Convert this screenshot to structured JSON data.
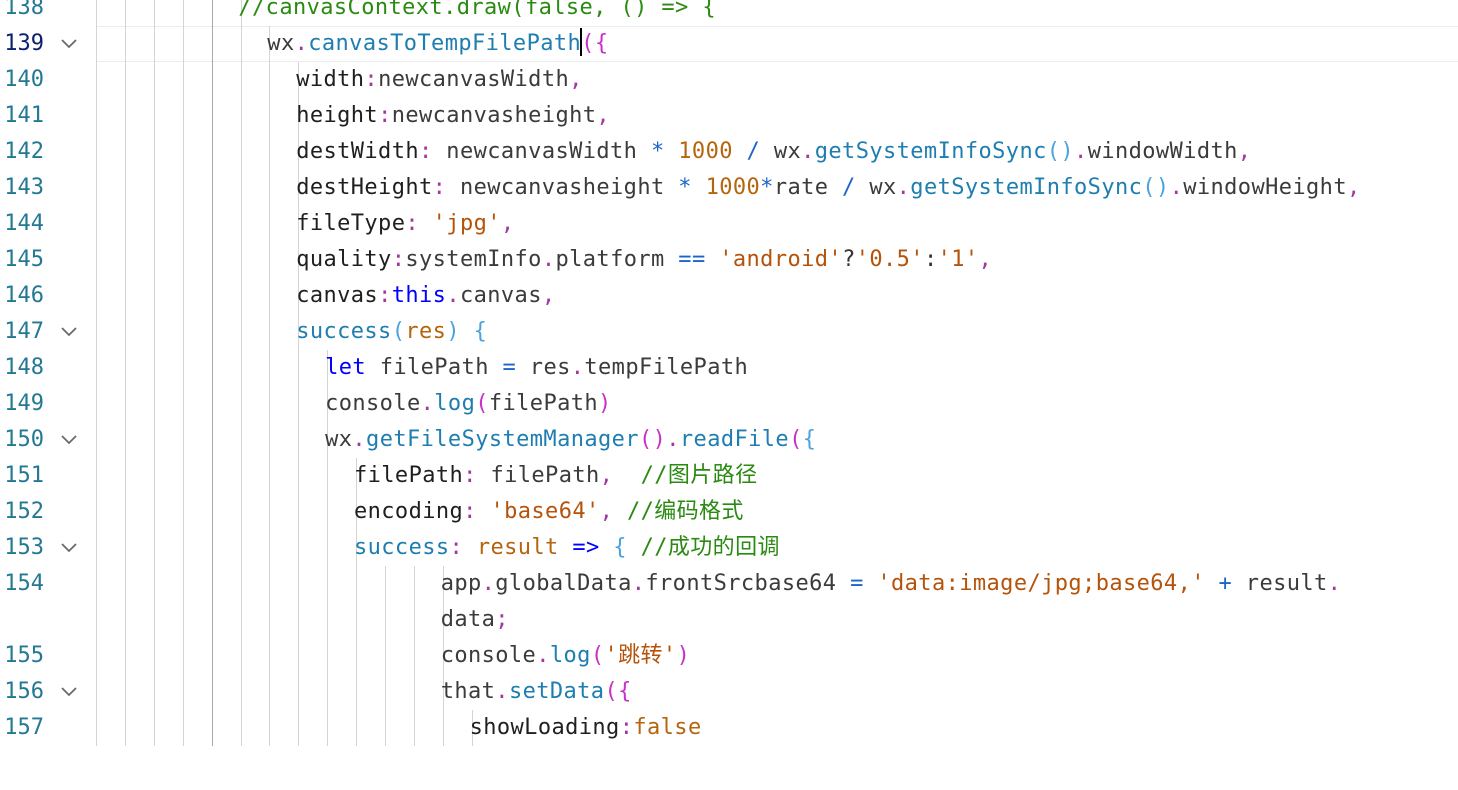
{
  "editor": {
    "language": "javascript",
    "active_line": "139",
    "lines": [
      {
        "no": "138",
        "fold": false,
        "indent": 6,
        "segments": [
          {
            "t": "//canvasContext.draw(false, () => {",
            "c": "com"
          }
        ]
      },
      {
        "no": "139",
        "fold": true,
        "indent": 7,
        "cursor_after": 2,
        "segments": [
          {
            "t": "wx",
            "c": "var"
          },
          {
            "t": ".",
            "c": "punc"
          },
          {
            "t": "canvasToTempFilePath",
            "c": "fn"
          },
          {
            "t": "(",
            "c": "brk1"
          },
          {
            "t": "{",
            "c": "brk1"
          }
        ]
      },
      {
        "no": "140",
        "fold": false,
        "indent": 8,
        "segments": [
          {
            "t": "width",
            "c": "prop"
          },
          {
            "t": ":",
            "c": "punc"
          },
          {
            "t": "newcanvasWidth",
            "c": "var"
          },
          {
            "t": ",",
            "c": "punc"
          }
        ]
      },
      {
        "no": "141",
        "fold": false,
        "indent": 8,
        "segments": [
          {
            "t": "height",
            "c": "prop"
          },
          {
            "t": ":",
            "c": "punc"
          },
          {
            "t": "newcanvasheight",
            "c": "var"
          },
          {
            "t": ",",
            "c": "punc"
          }
        ]
      },
      {
        "no": "142",
        "fold": false,
        "indent": 8,
        "segments": [
          {
            "t": "destWidth",
            "c": "prop"
          },
          {
            "t": ": ",
            "c": "punc"
          },
          {
            "t": "newcanvasWidth",
            "c": "var"
          },
          {
            "t": " * ",
            "c": "op"
          },
          {
            "t": "1000",
            "c": "num"
          },
          {
            "t": " / ",
            "c": "op"
          },
          {
            "t": "wx",
            "c": "var"
          },
          {
            "t": ".",
            "c": "punc"
          },
          {
            "t": "getSystemInfoSync",
            "c": "fn"
          },
          {
            "t": "()",
            "c": "brk2"
          },
          {
            "t": ".",
            "c": "punc"
          },
          {
            "t": "windowWidth",
            "c": "var"
          },
          {
            "t": ",",
            "c": "punc"
          }
        ]
      },
      {
        "no": "143",
        "fold": false,
        "indent": 8,
        "segments": [
          {
            "t": "destHeight",
            "c": "prop"
          },
          {
            "t": ": ",
            "c": "punc"
          },
          {
            "t": "newcanvasheight",
            "c": "var"
          },
          {
            "t": " * ",
            "c": "op"
          },
          {
            "t": "1000",
            "c": "num"
          },
          {
            "t": "*",
            "c": "op"
          },
          {
            "t": "rate",
            "c": "var"
          },
          {
            "t": " / ",
            "c": "op"
          },
          {
            "t": "wx",
            "c": "var"
          },
          {
            "t": ".",
            "c": "punc"
          },
          {
            "t": "getSystemInfoSync",
            "c": "fn"
          },
          {
            "t": "()",
            "c": "brk2"
          },
          {
            "t": ".",
            "c": "punc"
          },
          {
            "t": "windowHeight",
            "c": "var"
          },
          {
            "t": ",",
            "c": "punc"
          }
        ]
      },
      {
        "no": "144",
        "fold": false,
        "indent": 8,
        "segments": [
          {
            "t": "fileType",
            "c": "prop"
          },
          {
            "t": ": ",
            "c": "punc"
          },
          {
            "t": "'jpg'",
            "c": "str"
          },
          {
            "t": ",",
            "c": "punc"
          }
        ]
      },
      {
        "no": "145",
        "fold": false,
        "indent": 8,
        "segments": [
          {
            "t": "quality",
            "c": "prop"
          },
          {
            "t": ":",
            "c": "punc"
          },
          {
            "t": "systemInfo",
            "c": "var"
          },
          {
            "t": ".",
            "c": "punc"
          },
          {
            "t": "platform",
            "c": "var"
          },
          {
            "t": " == ",
            "c": "op"
          },
          {
            "t": "'android'",
            "c": "str"
          },
          {
            "t": "?",
            "c": "plain"
          },
          {
            "t": "'0.5'",
            "c": "str"
          },
          {
            "t": ":",
            "c": "plain"
          },
          {
            "t": "'1'",
            "c": "str"
          },
          {
            "t": ",",
            "c": "punc"
          }
        ]
      },
      {
        "no": "146",
        "fold": false,
        "indent": 8,
        "segments": [
          {
            "t": "canvas",
            "c": "prop"
          },
          {
            "t": ":",
            "c": "punc"
          },
          {
            "t": "this",
            "c": "this"
          },
          {
            "t": ".",
            "c": "punc"
          },
          {
            "t": "canvas",
            "c": "var"
          },
          {
            "t": ",",
            "c": "punc"
          }
        ]
      },
      {
        "no": "147",
        "fold": true,
        "indent": 8,
        "segments": [
          {
            "t": "success",
            "c": "fn"
          },
          {
            "t": "(",
            "c": "brk2"
          },
          {
            "t": "res",
            "c": "param"
          },
          {
            "t": ") ",
            "c": "brk2"
          },
          {
            "t": "{",
            "c": "brk2"
          }
        ]
      },
      {
        "no": "148",
        "fold": false,
        "indent": 9,
        "segments": [
          {
            "t": "let ",
            "c": "kw"
          },
          {
            "t": "filePath",
            "c": "var"
          },
          {
            "t": " = ",
            "c": "op"
          },
          {
            "t": "res",
            "c": "var"
          },
          {
            "t": ".",
            "c": "punc"
          },
          {
            "t": "tempFilePath",
            "c": "var"
          }
        ]
      },
      {
        "no": "149",
        "fold": false,
        "indent": 9,
        "segments": [
          {
            "t": "console",
            "c": "var"
          },
          {
            "t": ".",
            "c": "punc"
          },
          {
            "t": "log",
            "c": "fn"
          },
          {
            "t": "(",
            "c": "brk1"
          },
          {
            "t": "filePath",
            "c": "var"
          },
          {
            "t": ")",
            "c": "brk1"
          }
        ]
      },
      {
        "no": "150",
        "fold": true,
        "indent": 9,
        "segments": [
          {
            "t": "wx",
            "c": "var"
          },
          {
            "t": ".",
            "c": "punc"
          },
          {
            "t": "getFileSystemManager",
            "c": "fn"
          },
          {
            "t": "()",
            "c": "brk1"
          },
          {
            "t": ".",
            "c": "punc"
          },
          {
            "t": "readFile",
            "c": "fn"
          },
          {
            "t": "(",
            "c": "brk1"
          },
          {
            "t": "{",
            "c": "brk2"
          }
        ]
      },
      {
        "no": "151",
        "fold": false,
        "indent": 10,
        "segments": [
          {
            "t": "filePath",
            "c": "prop"
          },
          {
            "t": ": ",
            "c": "punc"
          },
          {
            "t": "filePath",
            "c": "var"
          },
          {
            "t": ",  ",
            "c": "punc"
          },
          {
            "t": "//图片路径",
            "c": "com"
          }
        ]
      },
      {
        "no": "152",
        "fold": false,
        "indent": 10,
        "segments": [
          {
            "t": "encoding",
            "c": "prop"
          },
          {
            "t": ": ",
            "c": "punc"
          },
          {
            "t": "'base64'",
            "c": "str"
          },
          {
            "t": ", ",
            "c": "punc"
          },
          {
            "t": "//编码格式",
            "c": "com"
          }
        ]
      },
      {
        "no": "153",
        "fold": true,
        "indent": 10,
        "segments": [
          {
            "t": "success",
            "c": "fn"
          },
          {
            "t": ": ",
            "c": "punc"
          },
          {
            "t": "result",
            "c": "param"
          },
          {
            "t": " => ",
            "c": "kw"
          },
          {
            "t": "{ ",
            "c": "brk2"
          },
          {
            "t": "//成功的回调",
            "c": "com"
          }
        ]
      },
      {
        "no": "154",
        "fold": false,
        "indent": 13,
        "segments": [
          {
            "t": "app",
            "c": "var"
          },
          {
            "t": ".",
            "c": "punc"
          },
          {
            "t": "globalData",
            "c": "var"
          },
          {
            "t": ".",
            "c": "punc"
          },
          {
            "t": "frontSrcbase64",
            "c": "var"
          },
          {
            "t": " = ",
            "c": "op"
          },
          {
            "t": "'data:image/jpg;base64,'",
            "c": "str"
          },
          {
            "t": " + ",
            "c": "op"
          },
          {
            "t": "result",
            "c": "var"
          },
          {
            "t": ".",
            "c": "punc"
          }
        ]
      },
      {
        "no": "",
        "fold": false,
        "indent": 13,
        "segments": [
          {
            "t": "data",
            "c": "var"
          },
          {
            "t": ";",
            "c": "punc"
          }
        ]
      },
      {
        "no": "155",
        "fold": false,
        "indent": 13,
        "segments": [
          {
            "t": "console",
            "c": "var"
          },
          {
            "t": ".",
            "c": "punc"
          },
          {
            "t": "log",
            "c": "fn"
          },
          {
            "t": "(",
            "c": "brk1"
          },
          {
            "t": "'跳转'",
            "c": "str"
          },
          {
            "t": ")",
            "c": "brk1"
          }
        ]
      },
      {
        "no": "156",
        "fold": true,
        "indent": 13,
        "segments": [
          {
            "t": "that",
            "c": "var"
          },
          {
            "t": ".",
            "c": "punc"
          },
          {
            "t": "setData",
            "c": "fn"
          },
          {
            "t": "(",
            "c": "brk1"
          },
          {
            "t": "{",
            "c": "brk1"
          }
        ]
      },
      {
        "no": "157",
        "fold": false,
        "indent": 14,
        "segments": [
          {
            "t": "showLoading",
            "c": "prop"
          },
          {
            "t": ":",
            "c": "punc"
          },
          {
            "t": "false",
            "c": "num"
          }
        ]
      }
    ]
  }
}
